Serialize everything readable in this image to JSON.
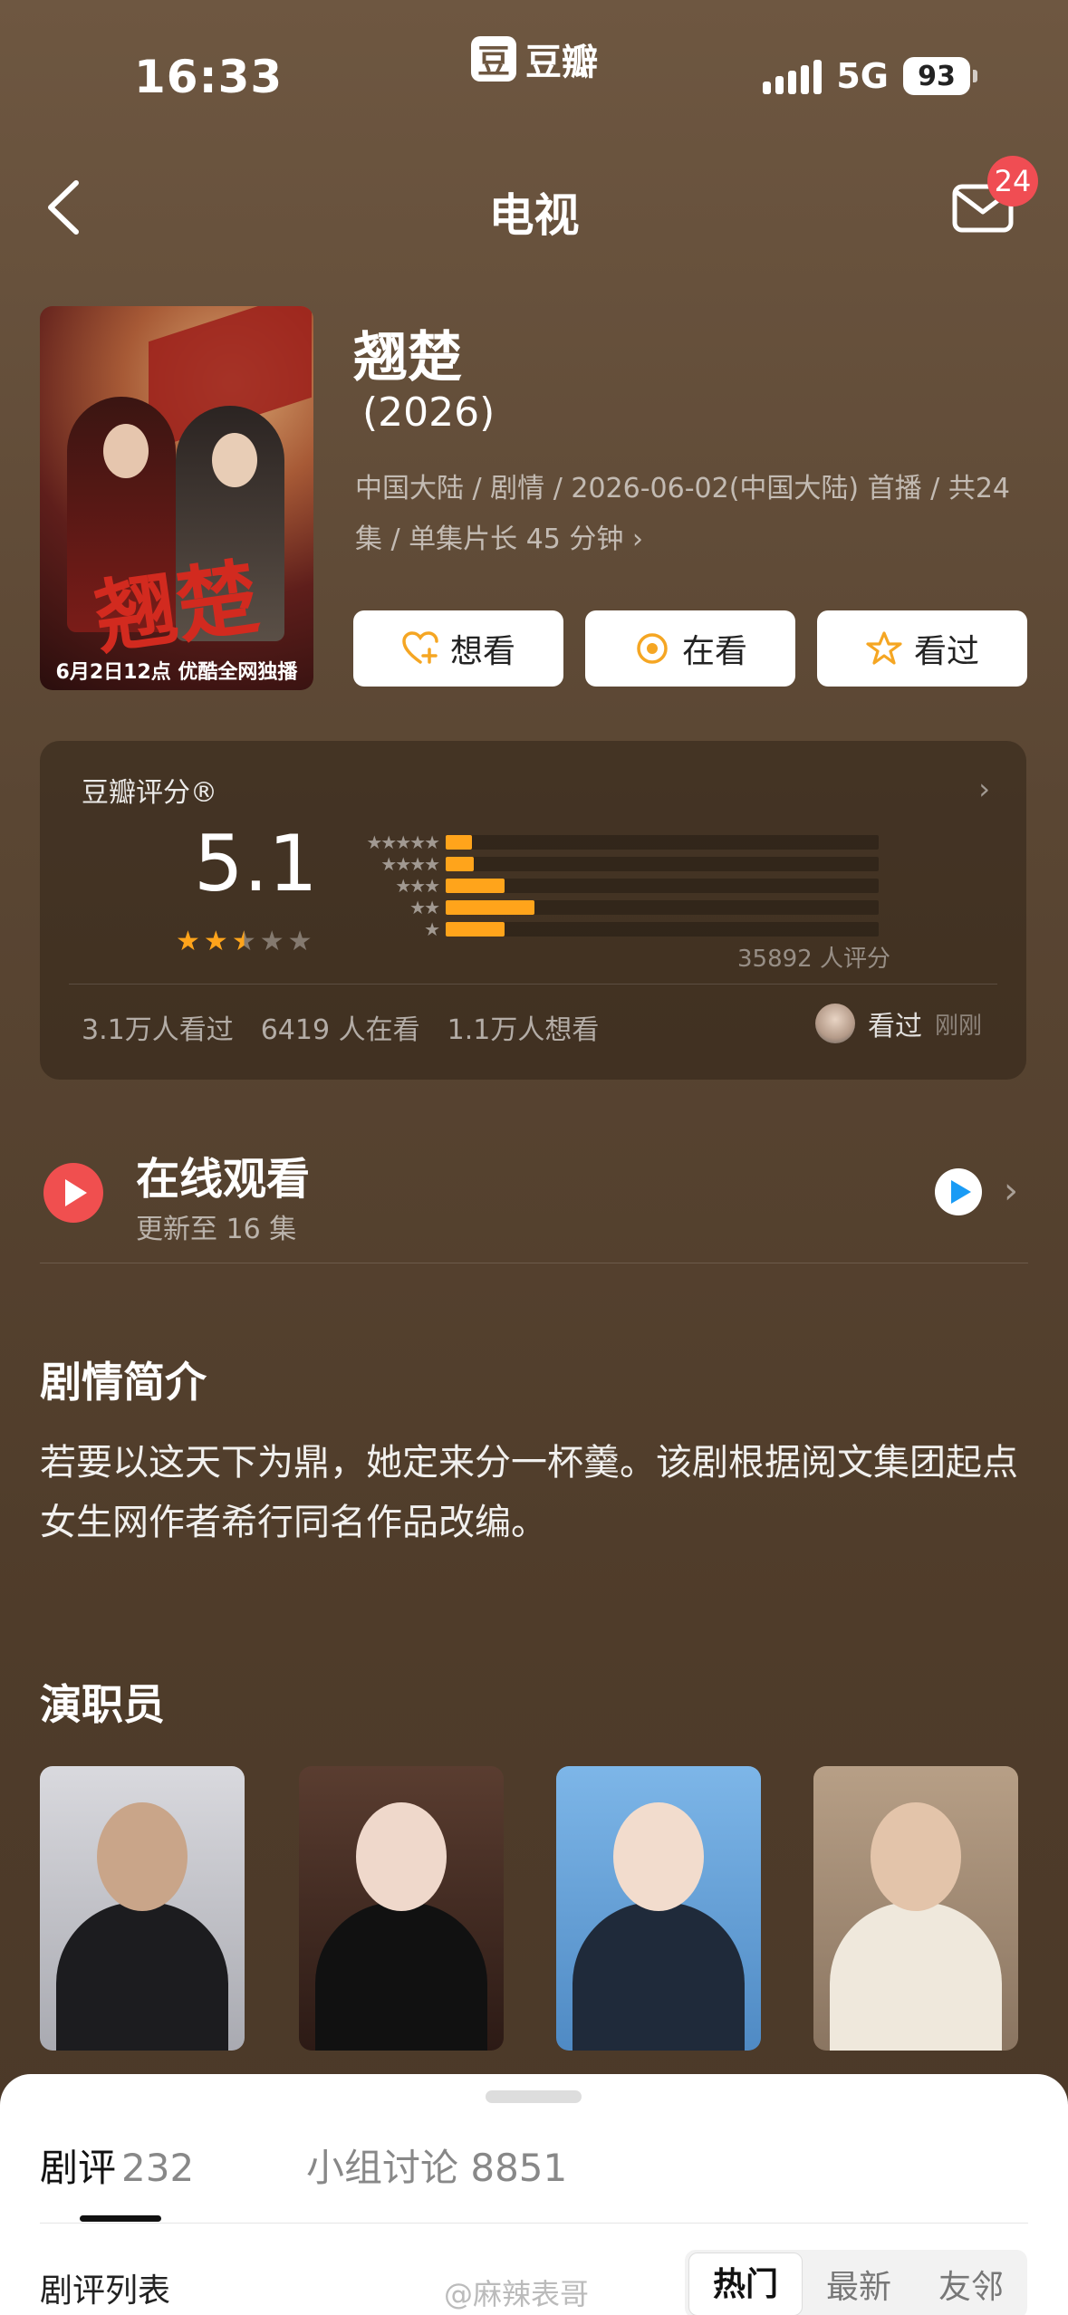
{
  "status_bar": {
    "time": "16:33",
    "app_logo_char": "豆",
    "app_name": "豆瓣",
    "network": "5G",
    "battery": "93"
  },
  "nav": {
    "title": "电视",
    "mail_badge": "24",
    "back_icon": "chevron-left-icon",
    "mail_icon": "envelope-icon"
  },
  "poster": {
    "logo_text": "翘楚",
    "caption": "6月2日12点 优酷全网独播"
  },
  "title": "翘楚",
  "year": "(2026)",
  "meta": "中国大陆 / 剧情 / 2026-06-02(中国大陆) 首播 / 共24集 / 单集片长 45 分钟 ›",
  "actions": [
    {
      "label": "想看",
      "icon": "heart-plus-icon"
    },
    {
      "label": "在看",
      "icon": "circle-dot-icon"
    },
    {
      "label": "看过",
      "icon": "star-icon"
    }
  ],
  "rating": {
    "label": "豆瓣评分®",
    "score": "5.1",
    "stars_value": 2.5,
    "distribution": [
      {
        "stars": "★★★★★",
        "fraction": 0.06
      },
      {
        "stars": "★★★★",
        "fraction": 0.065
      },
      {
        "stars": "★★★",
        "fraction": 0.135
      },
      {
        "stars": "★★",
        "fraction": 0.205
      },
      {
        "stars": "★",
        "fraction": 0.135
      }
    ],
    "count": "35892 人评分",
    "stats": [
      "3.1万人看过",
      "6419 人在看",
      "1.1万人想看"
    ],
    "watched_label": "看过",
    "watched_time": "刚刚"
  },
  "online": {
    "title": "在线观看",
    "subtitle": "更新至 16 集"
  },
  "synopsis": {
    "heading": "剧情简介",
    "text": "若要以这天下为鼎，她定来分一杯羹。该剧根据阅文集团起点女生网作者希行同名作品改编。"
  },
  "cast": {
    "heading": "演职员"
  },
  "sheet": {
    "tab1_label": "剧评",
    "tab1_count": "232",
    "tab2_label": "小组讨论 8851",
    "list_title": "剧评列表",
    "watermark": "@麻辣表哥",
    "segments": [
      "热门",
      "最新",
      "友邻"
    ]
  },
  "colors": {
    "accent": "#ffa41b",
    "badge": "#f04d53",
    "play": "#f04f4f"
  }
}
